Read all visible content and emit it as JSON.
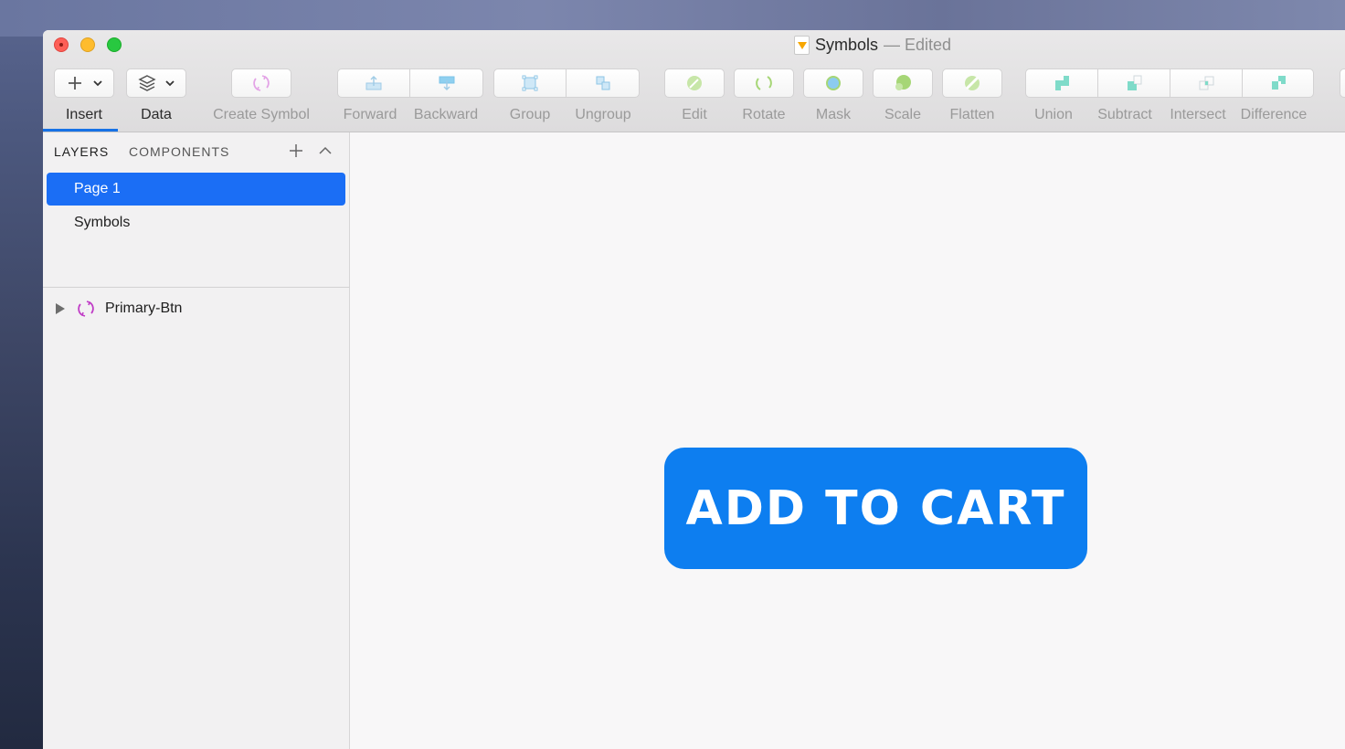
{
  "window": {
    "title": "Symbols",
    "status": "— Edited"
  },
  "toolbar": {
    "insert_label": "Insert",
    "data_label": "Data",
    "create_symbol_label": "Create Symbol",
    "forward_label": "Forward",
    "backward_label": "Backward",
    "group_label": "Group",
    "ungroup_label": "Ungroup",
    "edit_label": "Edit",
    "rotate_label": "Rotate",
    "mask_label": "Mask",
    "scale_label": "Scale",
    "flatten_label": "Flatten",
    "union_label": "Union",
    "subtract_label": "Subtract",
    "intersect_label": "Intersect",
    "difference_label": "Difference"
  },
  "sidebar": {
    "tab_layers": "LAYERS",
    "tab_components": "COMPONENTS",
    "pages": [
      {
        "label": "Page 1",
        "selected": true
      },
      {
        "label": "Symbols",
        "selected": false
      }
    ],
    "layers": [
      {
        "label": "Primary-Btn",
        "icon": "symbol-icon"
      }
    ]
  },
  "canvas": {
    "button_text": "ADD TO CART"
  },
  "colors": {
    "accent": "#1b6ef5",
    "cart_button": "#0d7ef0",
    "symbol_purple": "#c03cc6",
    "path_teal": "#7fdbc9",
    "transform_green": "#a6d676"
  }
}
